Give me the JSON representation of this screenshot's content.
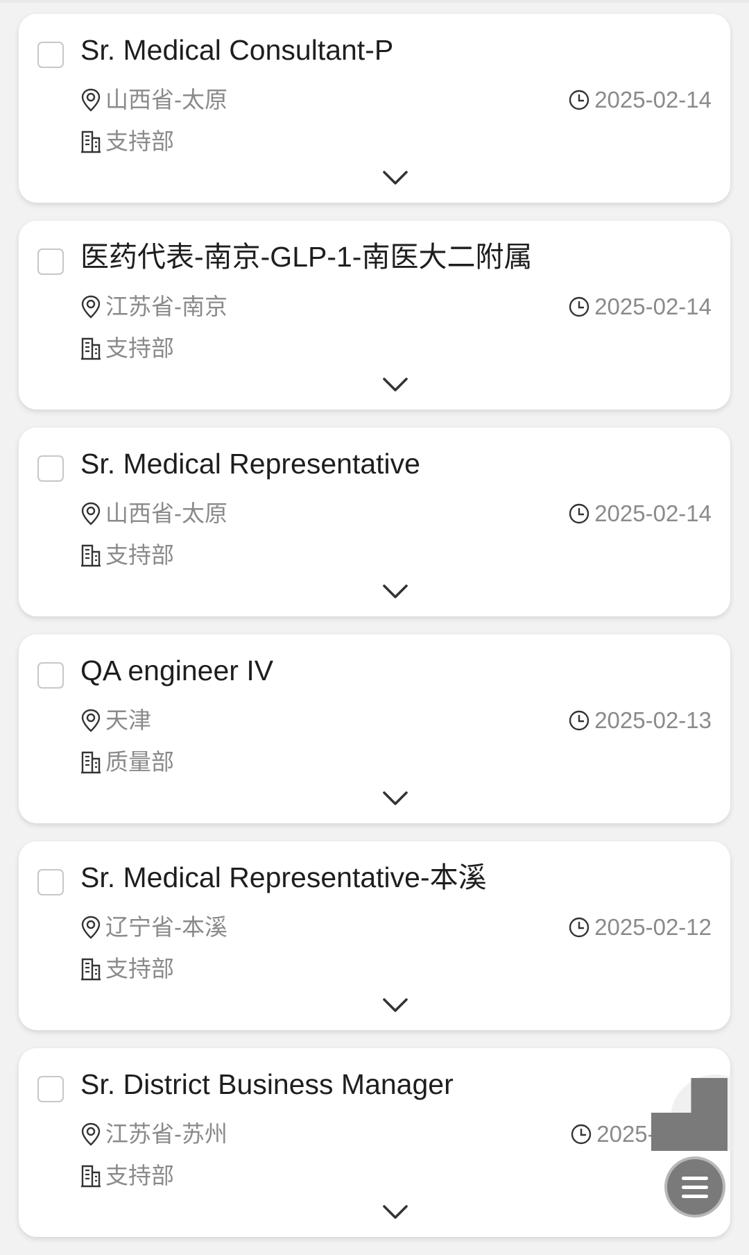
{
  "jobs": [
    {
      "title": "Sr. Medical Consultant-P",
      "location": "山西省-太原",
      "department": "支持部",
      "date": "2025-02-14"
    },
    {
      "title": "医药代表-南京-GLP-1-南医大二附属",
      "location": "江苏省-南京",
      "department": "支持部",
      "date": "2025-02-14"
    },
    {
      "title": "Sr. Medical Representative",
      "location": "山西省-太原",
      "department": "支持部",
      "date": "2025-02-14"
    },
    {
      "title": "QA engineer IV",
      "location": "天津",
      "department": "质量部",
      "date": "2025-02-13"
    },
    {
      "title": "Sr. Medical Representative-本溪",
      "location": "辽宁省-本溪",
      "department": "支持部",
      "date": "2025-02-12"
    },
    {
      "title": "Sr. District Business Manager",
      "location": "江苏省-苏州",
      "department": "支持部",
      "date": "2025-0"
    }
  ],
  "icons": {
    "location": "location-pin-icon",
    "department": "building-icon",
    "date": "clock-icon",
    "expand": "chevron-down-icon",
    "menu": "hamburger-menu-icon"
  },
  "colors": {
    "title": "#1e1e1e",
    "meta": "#8a8a8a",
    "card": "#ffffff",
    "background": "#f2f2f2",
    "fab": "#7a7a7a"
  }
}
